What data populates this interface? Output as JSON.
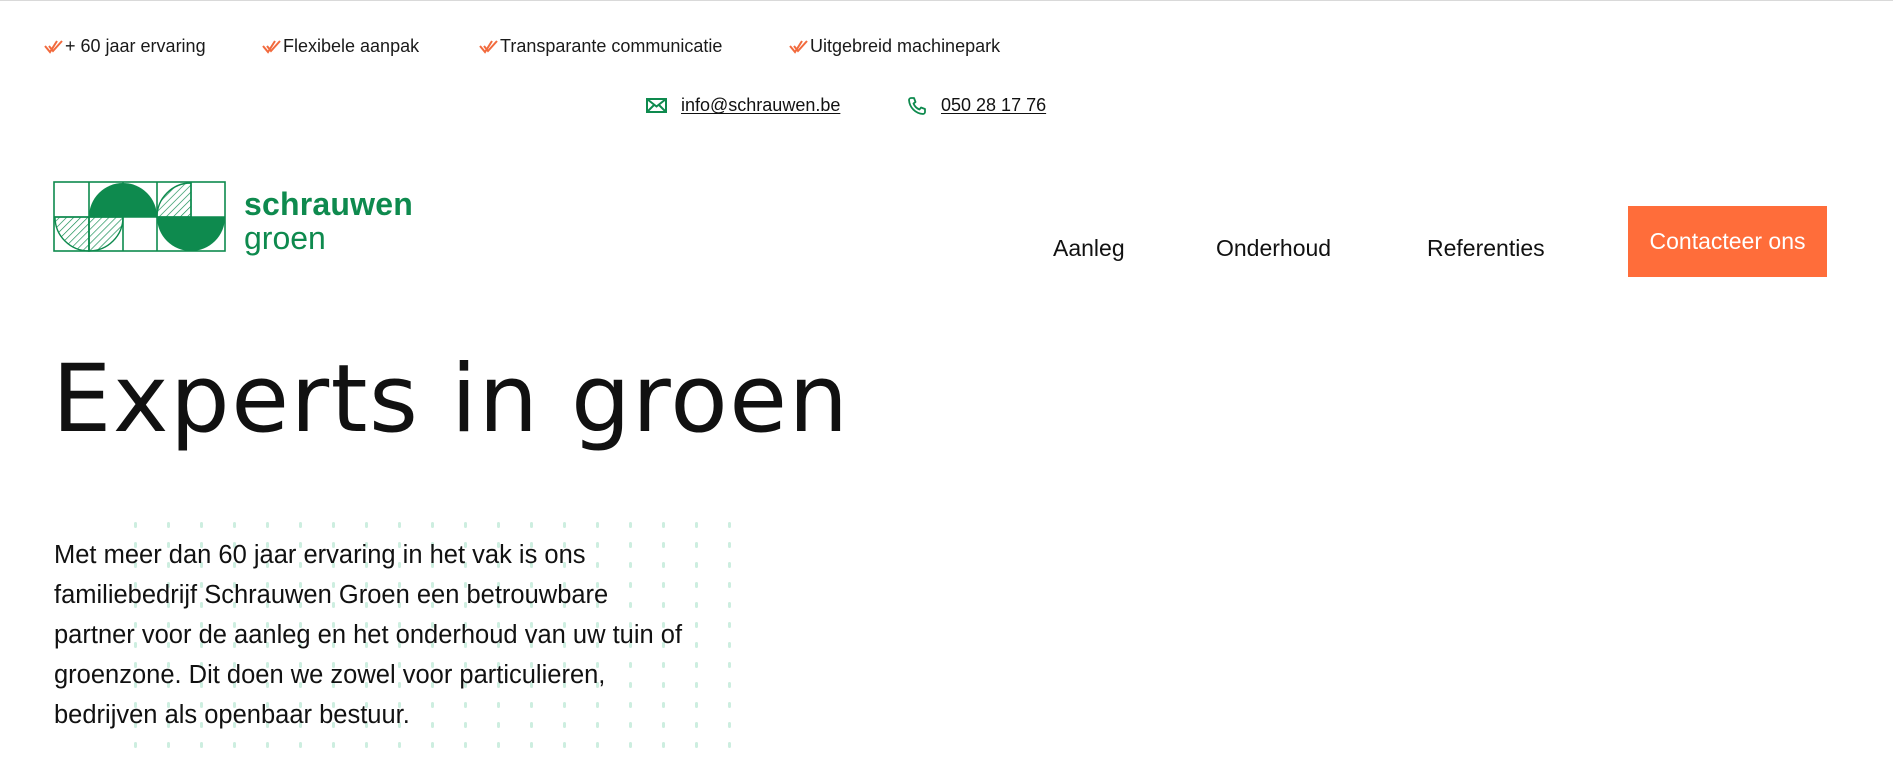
{
  "usps": [
    {
      "icon": "check-icon",
      "label": "+ 60 jaar ervaring"
    },
    {
      "icon": "check-icon",
      "label": "Flexibele aanpak"
    },
    {
      "icon": "check-icon",
      "label": "Transparante communicatie"
    },
    {
      "icon": "check-icon",
      "label": "Uitgebreid machinepark"
    }
  ],
  "contact": {
    "email": "info@schrauwen.be",
    "phone": "050 28 17 76"
  },
  "logo": {
    "line1": "schrauwen",
    "line2": "groen"
  },
  "nav": {
    "items": [
      "Aanleg",
      "Onderhoud",
      "Referenties"
    ],
    "cta": "Contacteer ons"
  },
  "hero": {
    "title": "Experts in groen",
    "lines": [
      "Met meer dan 60 jaar ervaring in het vak is ons",
      "familiebedrijf Schrauwen Groen een betrouwbare",
      "partner voor de aanleg en het onderhoud van uw tuin of",
      "groenzone. Dit doen we zowel voor particulieren,",
      "bedrijven als openbaar bestuur."
    ]
  },
  "colors": {
    "brand_green": "#0e8a4e",
    "accent_orange": "#ff6d3a",
    "check_orange": "#f26a3d"
  }
}
